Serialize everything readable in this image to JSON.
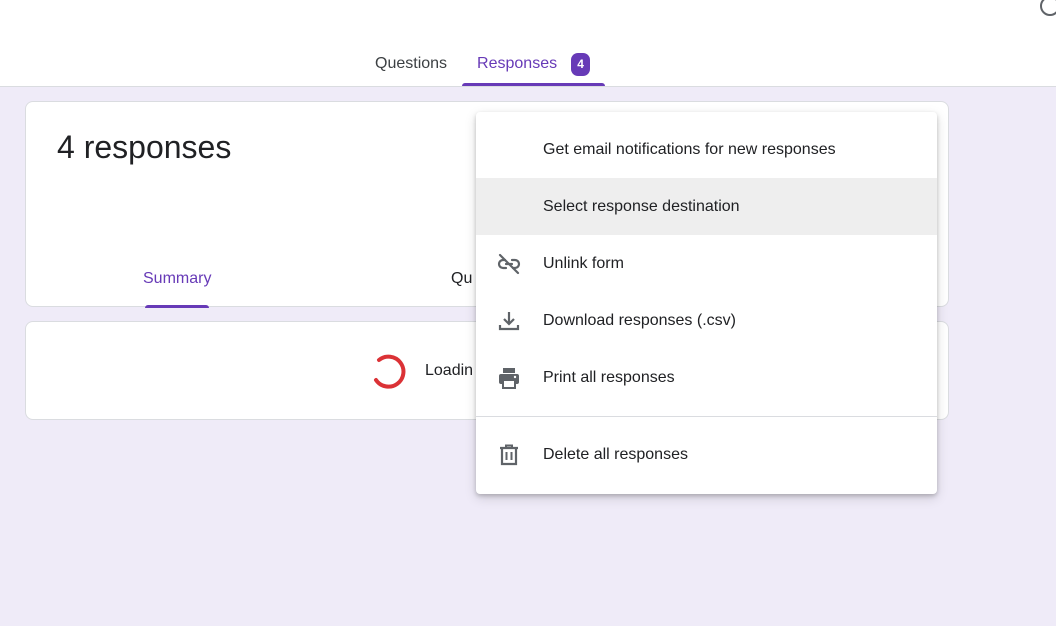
{
  "header": {
    "tabs": [
      {
        "label": "Questions",
        "active": false
      },
      {
        "label": "Responses",
        "active": true,
        "badge": "4"
      }
    ]
  },
  "summary_card": {
    "title": "4 responses",
    "subtabs": [
      {
        "label": "Summary",
        "active": true
      },
      {
        "label": "Qu",
        "active": false
      }
    ]
  },
  "loading": {
    "text": "Loadin"
  },
  "menu": {
    "items": [
      {
        "label": "Get email notifications for new responses",
        "icon": "none"
      },
      {
        "label": "Select response destination",
        "icon": "none",
        "highlighted": true
      },
      {
        "label": "Unlink form",
        "icon": "link-off-icon"
      },
      {
        "label": "Download responses (.csv)",
        "icon": "download-icon"
      },
      {
        "label": "Print all responses",
        "icon": "print-icon"
      }
    ],
    "danger_items": [
      {
        "label": "Delete all responses",
        "icon": "trash-icon"
      }
    ]
  },
  "colors": {
    "accent": "#673ab7",
    "background": "#efebf8",
    "spinner": "#db3236"
  }
}
